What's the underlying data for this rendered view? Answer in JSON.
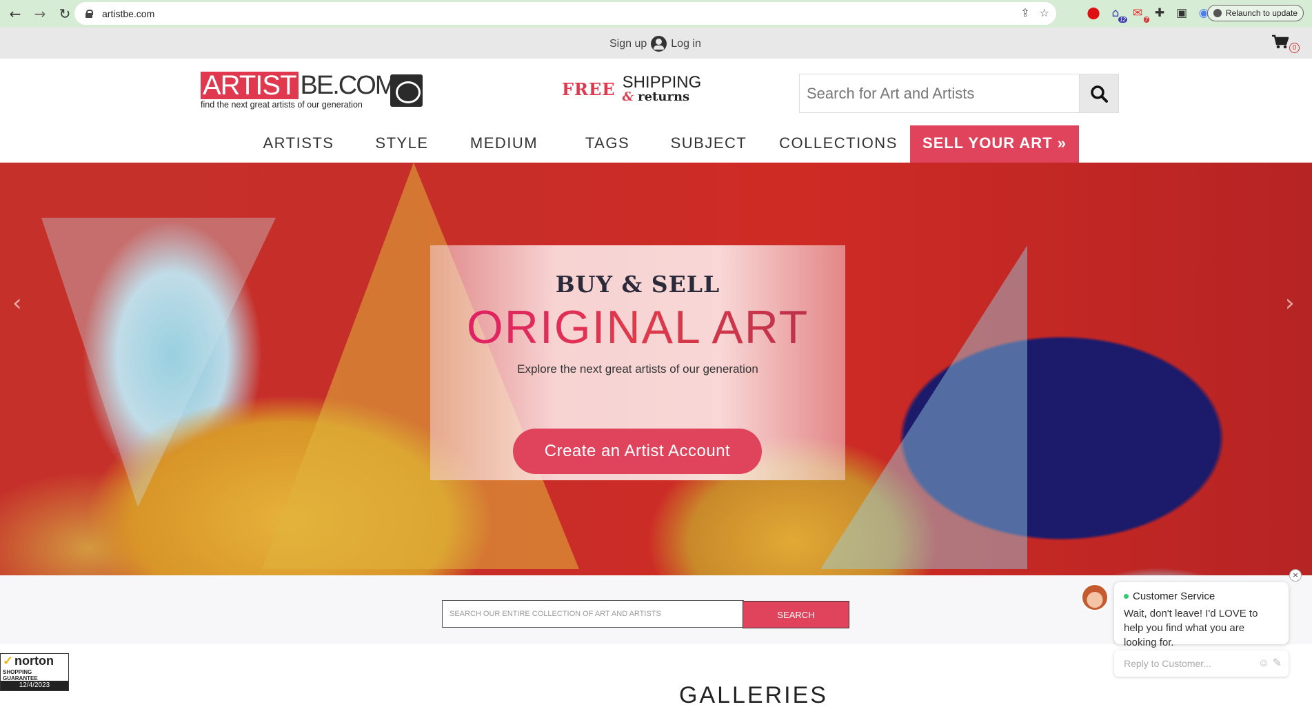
{
  "browser": {
    "url": "artistbe.com",
    "relaunch_label": "Relaunch to update",
    "extensions": [
      {
        "icon": "opera-icon",
        "badge": ""
      },
      {
        "icon": "extension-house-icon",
        "badge": "12"
      },
      {
        "icon": "gmail-icon",
        "badge": "7"
      },
      {
        "icon": "puzzle-icon",
        "badge": ""
      },
      {
        "icon": "sidepanel-icon",
        "badge": ""
      },
      {
        "icon": "profile-icon",
        "badge": ""
      }
    ]
  },
  "topbar": {
    "signup_label": "Sign up",
    "login_label": "Log in",
    "cart_count": "0"
  },
  "header": {
    "logo_red": "ARTIST",
    "logo_dark": "BE.COM",
    "logo_tagline": "find the next great artists of our generation",
    "shipping_free": "FREE",
    "shipping_title": "SHIPPING",
    "shipping_amp": "&",
    "shipping_returns": "returns",
    "search_placeholder": "Search for Art and Artists"
  },
  "menu": {
    "items": [
      "ARTISTS",
      "STYLE",
      "MEDIUM",
      "TAGS",
      "SUBJECT",
      "COLLECTIONS"
    ],
    "sell_label": "SELL YOUR ART »"
  },
  "hero": {
    "kicker": "BUY & SELL",
    "title": "ORIGINAL ART",
    "subtitle": "Explore the next great artists of our generation",
    "cta_label": "Create an Artist Account",
    "prev_arrow": "‹",
    "next_arrow": "›"
  },
  "collection_search": {
    "placeholder": "SEARCH OUR ENTIRE COLLECTION OF ART AND ARTISTS",
    "button_label": "SEARCH"
  },
  "section": {
    "galleries_title": "GALLERIES"
  },
  "norton": {
    "brand": "norton",
    "guarantee": "SHOPPING GUARANTEE",
    "date": "12/4/2023"
  },
  "chat": {
    "title": "Customer Service",
    "message": "Wait, don't leave! I'd LOVE to help you find what you are looking for.",
    "reply_placeholder": "Reply to Customer...",
    "close_label": "×"
  },
  "colors": {
    "brand_red": "#e0445c",
    "browser_chrome": "#d7ecd5"
  }
}
